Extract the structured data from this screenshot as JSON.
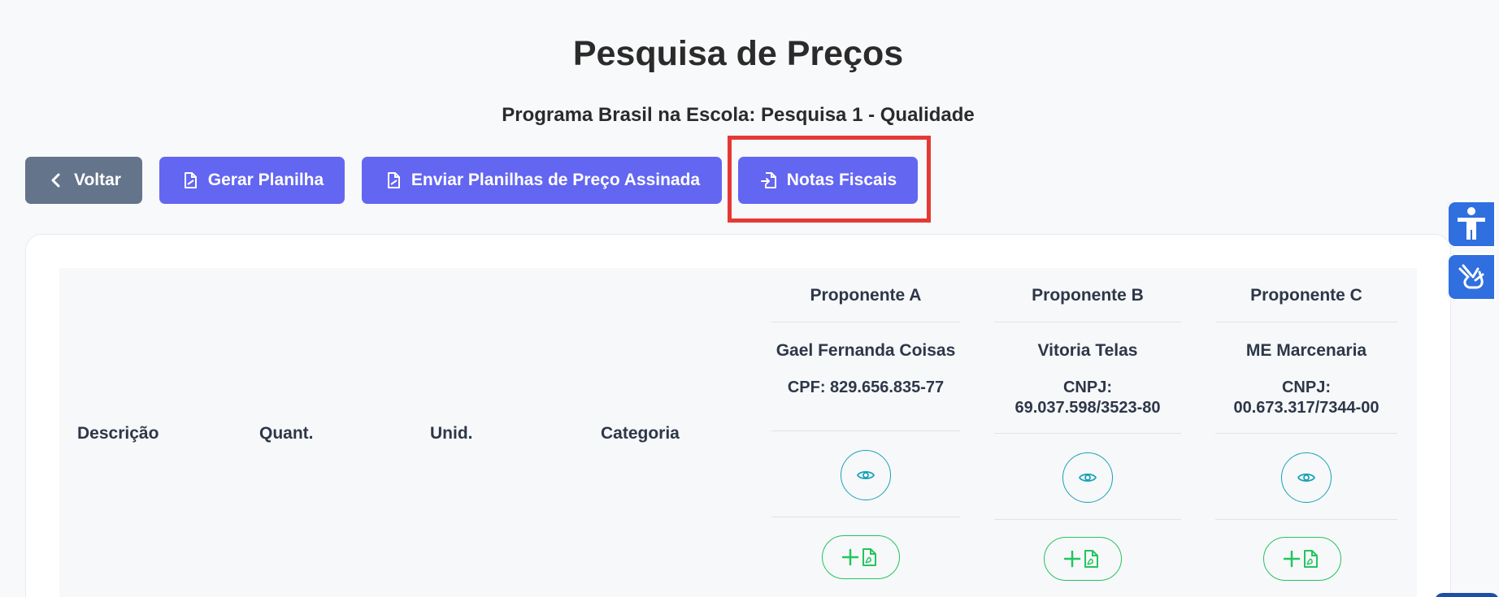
{
  "page": {
    "title": "Pesquisa de Preços",
    "subtitle": "Programa Brasil na Escola: Pesquisa 1 - Qualidade"
  },
  "toolbar": {
    "back_label": "Voltar",
    "gerar_label": "Gerar Planilha",
    "enviar_label": "Enviar Planilhas de Preço Assinada",
    "notas_label": "Notas Fiscais"
  },
  "table": {
    "headers": {
      "descricao": "Descrição",
      "quant": "Quant.",
      "unid": "Unid.",
      "categoria": "Categoria"
    },
    "proponentes": [
      {
        "title": "Proponente A",
        "name": "Gael Fernanda Coisas",
        "doc_line1": "CPF: 829.656.835-77",
        "doc_line2": ""
      },
      {
        "title": "Proponente B",
        "name": "Vitoria Telas",
        "doc_line1": "CNPJ:",
        "doc_line2": "69.037.598/3523-80"
      },
      {
        "title": "Proponente C",
        "name": "ME Marcenaria",
        "doc_line1": "CNPJ:",
        "doc_line2": "00.673.317/7344-00"
      }
    ]
  },
  "icons": {
    "back": "chevron-left-icon",
    "file": "file-icon",
    "file_import": "file-import-icon",
    "eye": "eye-icon",
    "add_pdf": "add-pdf-icon",
    "accessibility": "accessibility-icon",
    "sign_language": "sign-language-icon"
  },
  "colors": {
    "primary": "#6366f1",
    "secondary": "#64748b",
    "highlight": "#e53935",
    "info": "#17a2b8",
    "success": "#22c55e",
    "side_widget": "#2f6fe0"
  }
}
